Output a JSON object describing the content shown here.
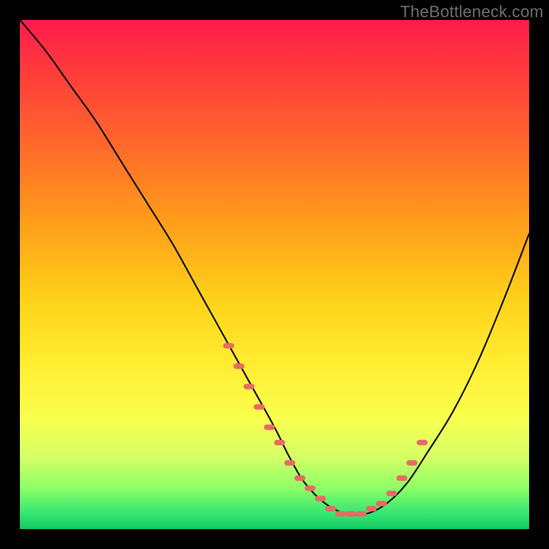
{
  "watermark": "TheBottleneck.com",
  "chart_data": {
    "type": "line",
    "title": "",
    "xlabel": "",
    "ylabel": "",
    "xlim": [
      0,
      100
    ],
    "ylim": [
      0,
      100
    ],
    "series": [
      {
        "name": "curve",
        "x": [
          0,
          5,
          10,
          15,
          20,
          25,
          30,
          35,
          40,
          45,
          50,
          53,
          56,
          60,
          64,
          68,
          72,
          76,
          80,
          85,
          90,
          95,
          100
        ],
        "values": [
          100,
          94,
          87,
          80,
          72,
          64,
          56,
          47,
          38,
          29,
          20,
          14,
          9,
          5,
          3,
          3,
          5,
          9,
          15,
          23,
          33,
          45,
          58
        ]
      }
    ],
    "markers": {
      "name": "highlight-dots",
      "color": "#e86a62",
      "x": [
        41,
        43,
        45,
        47,
        49,
        51,
        53,
        55,
        57,
        59,
        61,
        63,
        65,
        67,
        69,
        71,
        73,
        75,
        77,
        79
      ],
      "values": [
        36,
        32,
        28,
        24,
        20,
        17,
        13,
        10,
        8,
        6,
        4,
        3,
        3,
        3,
        4,
        5,
        7,
        10,
        13,
        17
      ]
    },
    "background_gradient": {
      "top": "#ff1a4d",
      "bottom": "#14c95f"
    }
  }
}
